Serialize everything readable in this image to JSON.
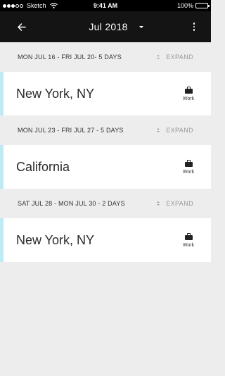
{
  "status_bar": {
    "carrier": "Sketch",
    "time": "9:41 AM",
    "battery": "100%"
  },
  "app_bar": {
    "title": "Jul 2018",
    "back_icon": "arrow-left-icon",
    "menu_icon": "more-vert-icon"
  },
  "weeks": [
    {
      "label": "MON JUL 16 - FRI JUL 20- 5 DAYS",
      "expand_label": "EXPAND",
      "trip": {
        "location": "New York, NY",
        "type": "Work",
        "type_icon": "briefcase-icon"
      }
    },
    {
      "label": "MON JUL 23 - FRI JUL 27 - 5 DAYS",
      "expand_label": "EXPAND",
      "trip": {
        "location": "California",
        "type": "Work",
        "type_icon": "briefcase-icon"
      }
    },
    {
      "label": "SAT JUL 28 - MON JUL 30 - 2 DAYS",
      "expand_label": "EXPAND",
      "trip": {
        "location": "New York, NY",
        "type": "Work",
        "type_icon": "briefcase-icon"
      }
    }
  ],
  "colors": {
    "accent_bar": "#bfe9f3",
    "app_bar_bg": "#141414",
    "background": "#ededed"
  }
}
